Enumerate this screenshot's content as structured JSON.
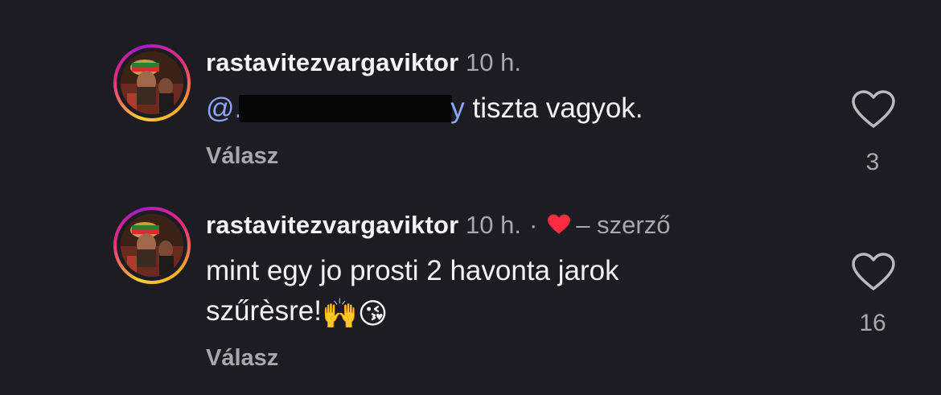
{
  "colors": {
    "background": "#1c1c22",
    "text": "#f3f3f3",
    "muted": "#a7a7ad",
    "mention": "#8aa6ff",
    "heart_red": "#ff2d3f"
  },
  "comments": [
    {
      "username": "rastavitezvargaviktor",
      "time": "10 h.",
      "mention_prefix": "@.",
      "mention_suffix": "y",
      "text": " tiszta vagyok.",
      "reply_label": "Válasz",
      "like_count": "3",
      "like_icon": "heart-outline-icon"
    },
    {
      "username": "rastavitezvargaviktor",
      "time": "10 h.",
      "separator": "·",
      "author_liked_icon": "red-heart-icon",
      "author_label": "– szerző",
      "text_line1": "mint egy jo prosti 2 havonta jarok",
      "text_line2": "szűrèsre!",
      "emojis": [
        "🙌",
        "😘"
      ],
      "reply_label": "Válasz",
      "like_count": "16",
      "like_icon": "heart-outline-icon"
    }
  ]
}
